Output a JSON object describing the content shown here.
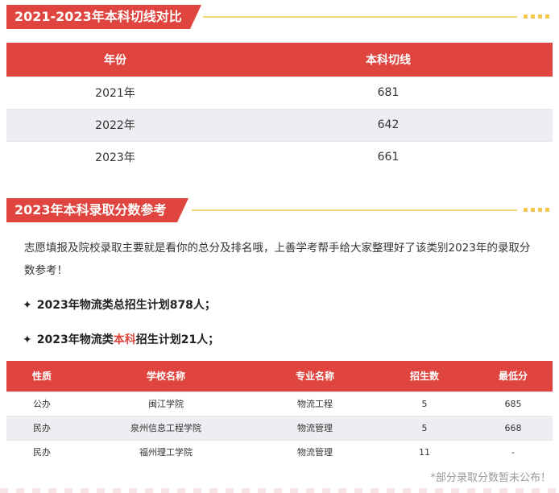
{
  "section1": {
    "title": "2021-2023年本科切线对比",
    "headers": [
      "年份",
      "本科切线"
    ],
    "rows": [
      [
        "2021年",
        "681"
      ],
      [
        "2022年",
        "642"
      ],
      [
        "2023年",
        "661"
      ]
    ]
  },
  "section2": {
    "title": "2023年本科录取分数参考",
    "intro": "志愿填报及院校录取主要就是看你的总分及排名哦，上善学考帮手给大家整理好了该类别2023年的录取分数参考！",
    "bullet1": "2023年物流类总招生计划878人；",
    "bullet2_pre": "2023年物流类",
    "bullet2_hl": "本科",
    "bullet2_post": "招生计划21人；",
    "star": "✦",
    "headers": [
      "性质",
      "学校名称",
      "专业名称",
      "招生数",
      "最低分"
    ],
    "rows": [
      [
        "公办",
        "闽江学院",
        "物流工程",
        "5",
        "685"
      ],
      [
        "民办",
        "泉州信息工程学院",
        "物流管理",
        "5",
        "668"
      ],
      [
        "民办",
        "福州理工学院",
        "物流管理",
        "11",
        "-"
      ]
    ],
    "note": "*部分录取分数暂未公布！"
  }
}
